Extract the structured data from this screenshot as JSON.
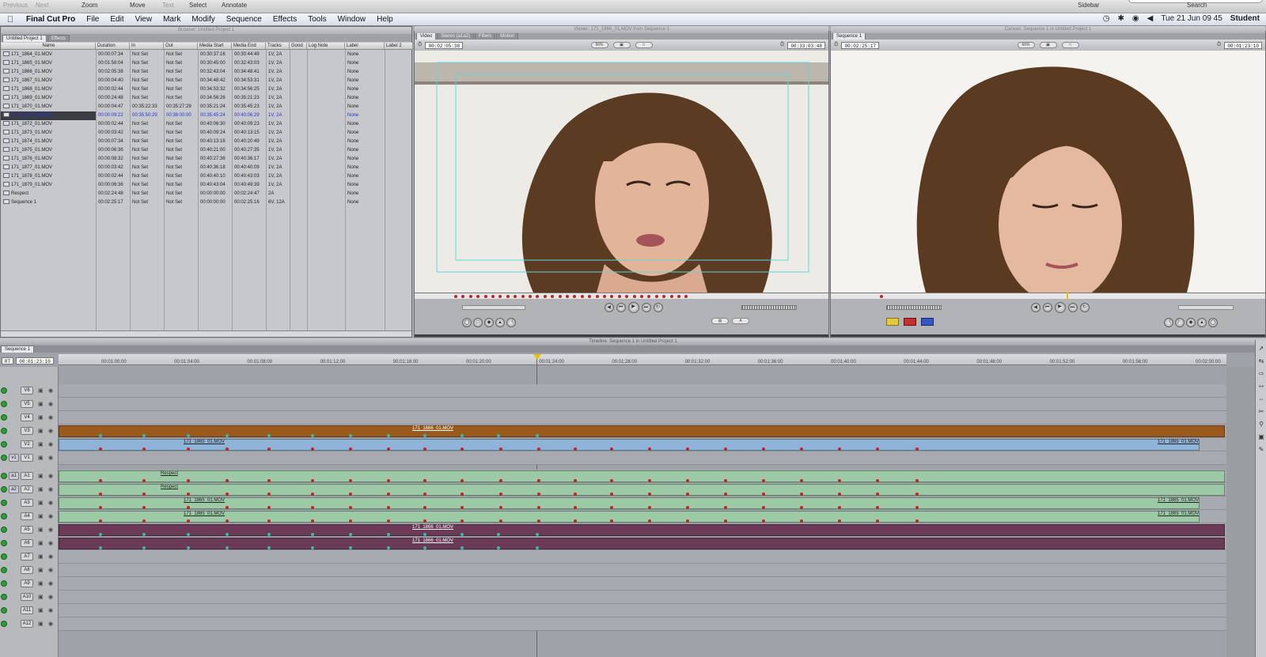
{
  "toolbar": {
    "previous": "Previous",
    "next": "Next",
    "zoom": "Zoom",
    "move": "Move",
    "text": "Text",
    "select": "Select",
    "annotate": "Annotate",
    "sidebar": "Sidebar",
    "search": "Search"
  },
  "menubar": {
    "app": "Final Cut Pro",
    "items": [
      "File",
      "Edit",
      "View",
      "Mark",
      "Modify",
      "Sequence",
      "Effects",
      "Tools",
      "Window",
      "Help"
    ],
    "clock": "Tue 21 Jun  09 45",
    "user": "Student"
  },
  "browser": {
    "title": "Browser: Untitled Project 1",
    "tabs": [
      "Untitled Project 1",
      "Effects"
    ],
    "columns": [
      "Name",
      "Duration",
      "In",
      "Out",
      "Media Start",
      "Media End",
      "Tracks",
      "Good",
      "Log Note",
      "Label",
      "Label 2"
    ],
    "rows": [
      [
        "171_1864_01.MOV",
        "00:00:07:34",
        "Not Set",
        "Not Set",
        "00:30:37:16",
        "00:30:44:49",
        "1V, 2A",
        "None"
      ],
      [
        "171_1865_01.MOV",
        "00:01:58:04",
        "Not Set",
        "Not Set",
        "00:30:45:00",
        "00:32:43:03",
        "1V, 2A",
        "None"
      ],
      [
        "171_1866_01.MOV",
        "00:02:05:38",
        "Not Set",
        "Not Set",
        "00:32:43:04",
        "00:34:48:41",
        "1V, 2A",
        "None"
      ],
      [
        "171_1867_01.MOV",
        "00:00:04:40",
        "Not Set",
        "Not Set",
        "00:34:48:42",
        "00:34:53:31",
        "1V, 2A",
        "None"
      ],
      [
        "171_1868_01.MOV",
        "00:00:02:44",
        "Not Set",
        "Not Set",
        "00:34:53:32",
        "00:34:56:25",
        "1V, 2A",
        "None"
      ],
      [
        "171_1869_01.MOV",
        "00:00:24:48",
        "Not Set",
        "Not Set",
        "00:34:56:26",
        "00:35:21:23",
        "1V, 2A",
        "None"
      ],
      [
        "171_1870_01.MOV",
        "00:00:04:47",
        "00:35:22:33",
        "00:35:27:29",
        "00:35:21:24",
        "00:35:45:23",
        "1V, 2A",
        "None"
      ],
      [
        "171_1871_01.MOV",
        "00:00:09:22",
        "00:35:50:29",
        "00:36:00:00",
        "00:35:45:24",
        "00:40:06:29",
        "1V, 2A",
        "None"
      ],
      [
        "171_1872_01.MOV",
        "00:00:02:44",
        "Not Set",
        "Not Set",
        "00:40:06:30",
        "00:40:09:23",
        "1V, 2A",
        "None"
      ],
      [
        "171_1873_01.MOV",
        "00:00:03:42",
        "Not Set",
        "Not Set",
        "00:40:09:24",
        "00:40:13:15",
        "1V, 2A",
        "None"
      ],
      [
        "171_1874_01.MOV",
        "00:00:07:34",
        "Not Set",
        "Not Set",
        "00:40:13:16",
        "00:40:20:49",
        "1V, 2A",
        "None"
      ],
      [
        "171_1875_01.MOV",
        "00:00:06:36",
        "Not Set",
        "Not Set",
        "00:40:21:00",
        "00:40:27:35",
        "1V, 2A",
        "None"
      ],
      [
        "171_1876_01.MOV",
        "00:00:08:32",
        "Not Set",
        "Not Set",
        "00:40:27:36",
        "00:40:36:17",
        "1V, 2A",
        "None"
      ],
      [
        "171_1877_01.MOV",
        "00:00:03:42",
        "Not Set",
        "Not Set",
        "00:40:36:18",
        "00:40:40:09",
        "1V, 2A",
        "None"
      ],
      [
        "171_1878_01.MOV",
        "00:00:02:44",
        "Not Set",
        "Not Set",
        "00:40:40:10",
        "00:40:43:03",
        "1V, 2A",
        "None"
      ],
      [
        "171_1879_01.MOV",
        "00:00:06:36",
        "Not Set",
        "Not Set",
        "00:40:43:04",
        "00:40:49:39",
        "1V, 2A",
        "None"
      ],
      [
        "Respect",
        "00:02:24:48",
        "Not Set",
        "Not Set",
        "00:00:00:00",
        "00:02:24:47",
        "2A",
        "None"
      ],
      [
        "Sequence 1",
        "00:02:25:17",
        "Not Set",
        "Not Set",
        "00:00:00:00",
        "00:02:25:16",
        "6V, 12A",
        "None"
      ]
    ],
    "selected_row": 7
  },
  "viewer": {
    "title": "Viewer: 171_1866_01.MOV from Sequence 1",
    "tabs": [
      "Video",
      "Stereo (a1a2)",
      "Filters",
      "Motion"
    ],
    "duration": "00:02:05:38",
    "timecode": "00:33:03:48",
    "zoom": "66%"
  },
  "canvas": {
    "title": "Canvas: Sequence 1 in Untitled Project 1",
    "tab": "Sequence 1",
    "duration": "00:02:25:17",
    "timecode": "00:01:23:10",
    "zoom": "66%"
  },
  "timeline": {
    "title": "Timeline: Sequence 1 in Untitled Project 1",
    "tab": "Sequence 1",
    "rt": "RT",
    "timecode": "00:01:23:10",
    "ruler": [
      "00:01:00:00",
      "00:01:04:00",
      "00:01:08:00",
      "00:01:12:00",
      "00:01:16:00",
      "00:01:20:00",
      "00:01:24:00",
      "00:01:28:00",
      "00:01:32:00",
      "00:01:36:00",
      "00:01:40:00",
      "00:01:44:00",
      "00:01:48:00",
      "00:01:52:00",
      "00:01:56:00",
      "00:02:00:00"
    ],
    "video_tracks": [
      "V6",
      "V5",
      "V4",
      "V3",
      "V2",
      "V1"
    ],
    "audio_tracks": [
      "A1",
      "A2",
      "A3",
      "A4",
      "A5",
      "A6",
      "A7",
      "A8",
      "A9",
      "A10",
      "A11",
      "A12"
    ],
    "src_v": "v1",
    "src_a1": "a1",
    "src_a2": "a2",
    "clips": {
      "v3": "171_1866_01.MOV",
      "v2a": "171_1865_01.MOV",
      "v2b": "171_1865_01.MOV",
      "a1": "Respect",
      "a2": "Respect",
      "a3a": "171_1865_01.MOV",
      "a3b": "171_1865_01.MOV",
      "a4a": "171_1865_01.MOV",
      "a4b": "171_1865_01.MOV",
      "a5": "171_1866_01.MOV",
      "a6": "171_1866_01.MOV"
    },
    "colors": {
      "v3": "#9a5a1e",
      "v2": "#8fb4d8",
      "audio": "#9ccaa6",
      "audio_purple": "#6b3a57",
      "marker_red": "#c02424",
      "marker_teal": "#3fb3b0"
    }
  }
}
